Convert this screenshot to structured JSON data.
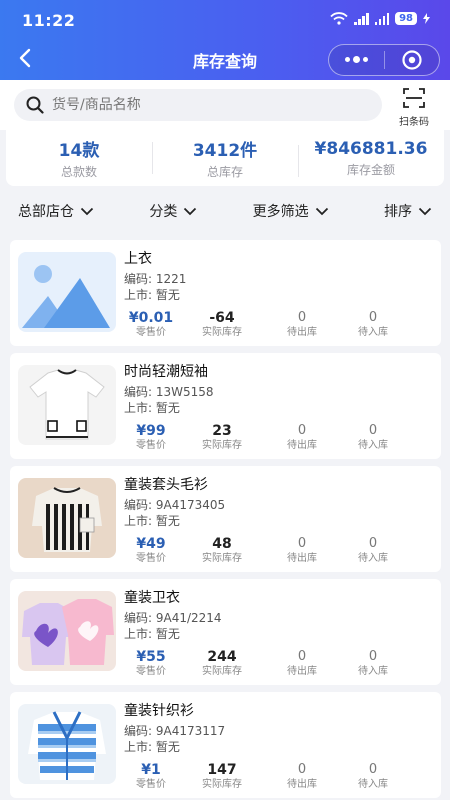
{
  "status_bar": {
    "time": "11:22",
    "battery": "98"
  },
  "nav": {
    "title": "库存查询"
  },
  "search": {
    "placeholder": "货号/商品名称",
    "value": "",
    "scan_label": "扫条码"
  },
  "summary": [
    {
      "value": "14款",
      "label": "总款数"
    },
    {
      "value": "3412件",
      "label": "总库存"
    },
    {
      "value": "¥846881.36",
      "label": "库存金额"
    }
  ],
  "filters": [
    {
      "label": "总部店仓"
    },
    {
      "label": "分类"
    },
    {
      "label": "更多筛选"
    },
    {
      "label": "排序"
    }
  ],
  "stat_labels": {
    "price": "零售价",
    "actual": "实际库存",
    "outgoing": "待出库",
    "incoming": "待入库"
  },
  "products": [
    {
      "name": "上衣",
      "code": "编码: 1221",
      "listing": "上市: 暂无",
      "price": "¥0.01",
      "actual": "-64",
      "outgoing": "0",
      "incoming": "0",
      "image": "placeholder-image-icon"
    },
    {
      "name": "时尚轻潮短袖",
      "code": "编码: 13W5158",
      "listing": "上市: 暂无",
      "price": "¥99",
      "actual": "23",
      "outgoing": "0",
      "incoming": "0",
      "image": "white-tshirt"
    },
    {
      "name": "童装套头毛衫",
      "code": "编码: 9A4173405",
      "listing": "上市: 暂无",
      "price": "¥49",
      "actual": "48",
      "outgoing": "0",
      "incoming": "0",
      "image": "striped-sweater"
    },
    {
      "name": "童装卫衣",
      "code": "编码: 9A41/2214",
      "listing": "上市: 暂无",
      "price": "¥55",
      "actual": "244",
      "outgoing": "0",
      "incoming": "0",
      "image": "pink-purple-hoodies"
    },
    {
      "name": "童装针织衫",
      "code": "编码: 9A4173117",
      "listing": "上市: 暂无",
      "price": "¥1",
      "actual": "147",
      "outgoing": "0",
      "incoming": "0",
      "image": "blue-knit-cardigan"
    }
  ]
}
